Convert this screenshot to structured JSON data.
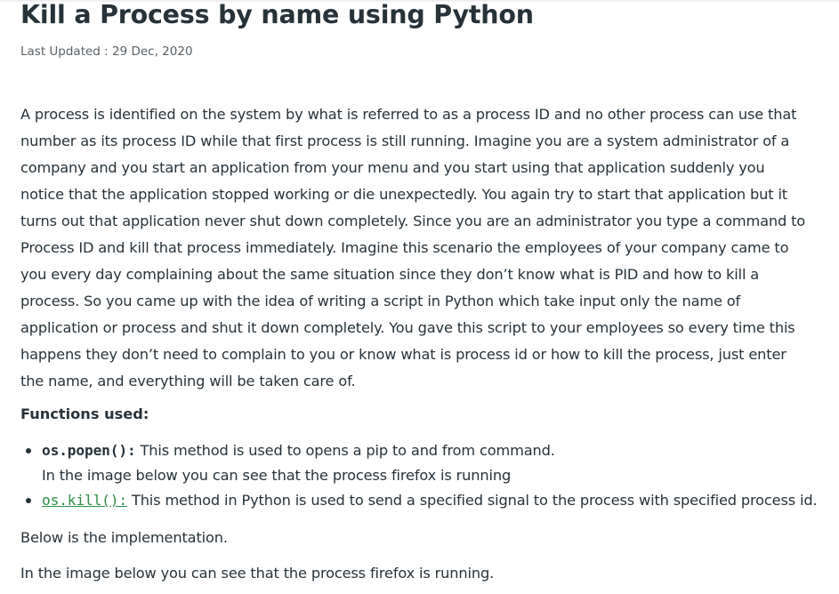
{
  "article": {
    "title": "Kill a Process by name using Python",
    "last_updated": "Last Updated : 29 Dec, 2020",
    "intro_lines": [
      "A process is identified on the system by what is referred to as a process ID and no other process can use that",
      "number as its process ID while that first process is still running. Imagine you are a system administrator of a",
      "company and you start an application from your menu and you start using that application suddenly you",
      "notice that the application stopped working or die unexpectedly. You again try to start that application but it",
      "turns out that application never shut down completely. Since you are an administrator you type a command to",
      "Process ID and kill that process immediately. Imagine this scenario the employees of your company came to",
      "you every day complaining about the same situation since they don’t know what is PID and how to kill a",
      "process. So you came up with the idea of writing a script in Python which take input only the name of",
      "application or process and shut it down completely. You gave this script to your employees so every time this",
      "happens they don’t need to complain to you or know what is process id or how to kill the process, just enter",
      "the name, and everything will be taken care of."
    ],
    "functions_heading": "Functions used:",
    "functions": [
      {
        "name": "os.popen():",
        "description": " This method is used to opens a pip to and from command.",
        "extra": "In the image below you can see that the process firefox is running"
      },
      {
        "name": "os.kill():",
        "description": " This method in Python is used to send a specified signal to the process with specified process id."
      }
    ],
    "implementation_text": "Below is the implementation.",
    "image_caption": "In the image below you can see that the process firefox is running."
  },
  "colors": {
    "text": "#273239",
    "link": "#2f8d46",
    "meta": "#5b6166"
  }
}
